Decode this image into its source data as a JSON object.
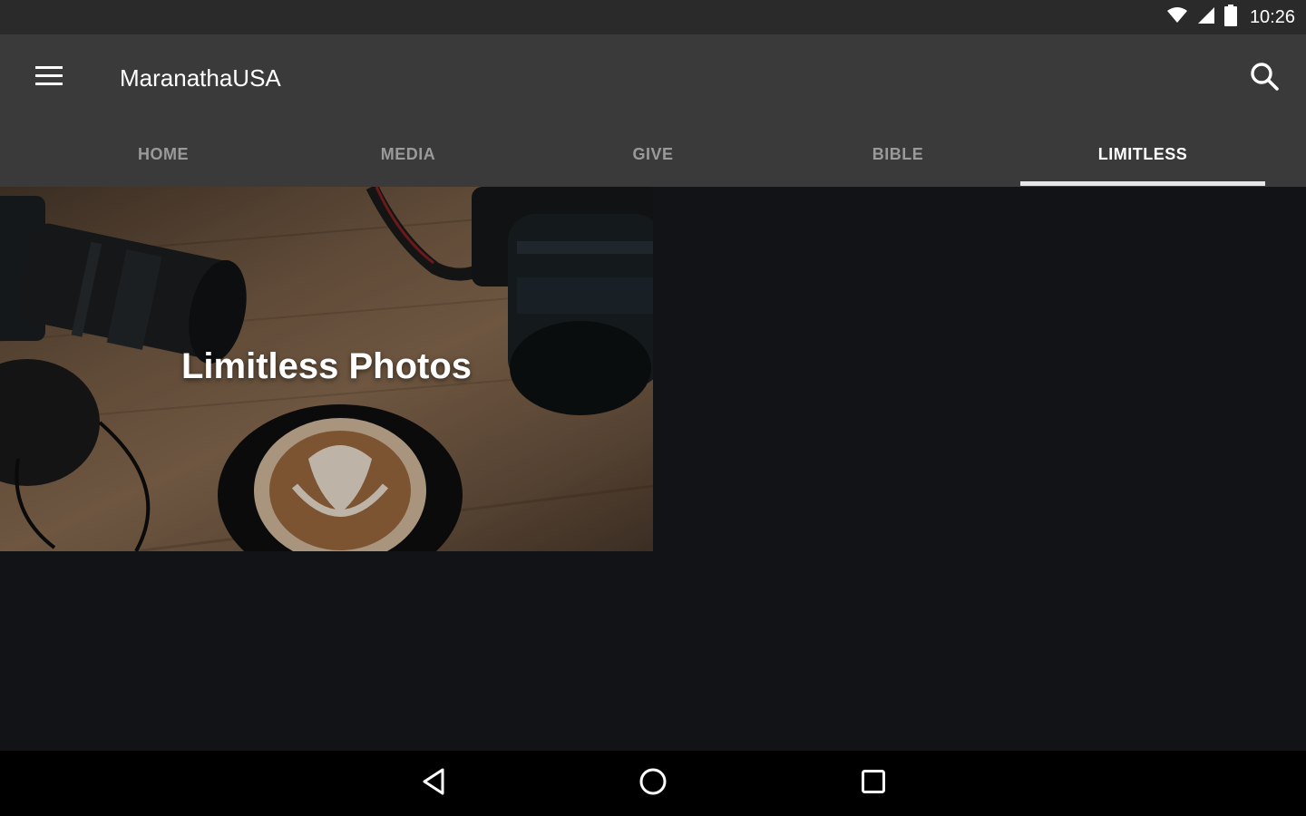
{
  "status_bar": {
    "time": "10:26",
    "icons": [
      "wifi-icon",
      "signal-icon",
      "battery-icon"
    ]
  },
  "app_bar": {
    "title": "MaranathaUSA",
    "menu_icon": "hamburger-menu-icon",
    "search_icon": "search-icon"
  },
  "tabs": [
    {
      "label": "HOME",
      "active": false
    },
    {
      "label": "MEDIA",
      "active": false
    },
    {
      "label": "GIVE",
      "active": false
    },
    {
      "label": "BIBLE",
      "active": false
    },
    {
      "label": "LIMITLESS",
      "active": true
    }
  ],
  "content": {
    "cards": [
      {
        "title": "Limitless Photos",
        "image": "cameras-and-latte-photo"
      }
    ]
  },
  "nav_bar": {
    "icons": [
      "back-icon",
      "home-icon",
      "recents-icon"
    ]
  },
  "colors": {
    "status_bar_bg": "#2a2a2a",
    "app_bar_bg": "#3a3a3a",
    "content_bg": "#111317",
    "nav_bar_bg": "#000000",
    "tab_inactive": "#9a9a9a",
    "tab_active": "#ffffff"
  }
}
